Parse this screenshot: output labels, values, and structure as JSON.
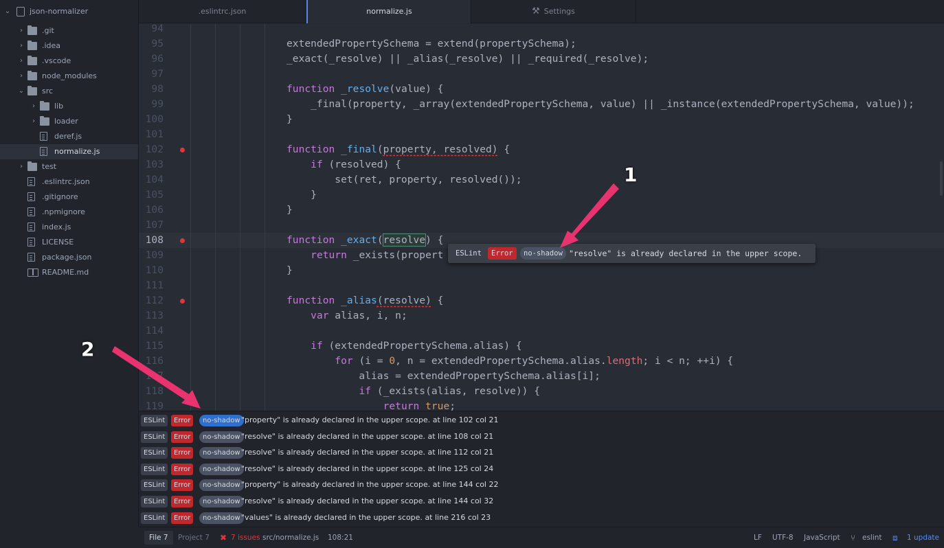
{
  "sidebar": {
    "project": "json-normalizer",
    "items": [
      {
        "label": ".git",
        "type": "folder",
        "depth": 0
      },
      {
        "label": ".idea",
        "type": "folder",
        "depth": 0
      },
      {
        "label": ".vscode",
        "type": "folder",
        "depth": 0
      },
      {
        "label": "node_modules",
        "type": "folder",
        "depth": 0
      },
      {
        "label": "src",
        "type": "folder-open",
        "depth": 0
      },
      {
        "label": "lib",
        "type": "folder",
        "depth": 1
      },
      {
        "label": "loader",
        "type": "folder",
        "depth": 1
      },
      {
        "label": "deref.js",
        "type": "file",
        "depth": 1
      },
      {
        "label": "normalize.js",
        "type": "file",
        "depth": 1,
        "selected": true
      },
      {
        "label": "test",
        "type": "folder",
        "depth": 0
      },
      {
        "label": ".eslintrc.json",
        "type": "file",
        "depth": 0
      },
      {
        "label": ".gitignore",
        "type": "file",
        "depth": 0
      },
      {
        "label": ".npmignore",
        "type": "file",
        "depth": 0
      },
      {
        "label": "index.js",
        "type": "file",
        "depth": 0
      },
      {
        "label": "LICENSE",
        "type": "file",
        "depth": 0
      },
      {
        "label": "package.json",
        "type": "file",
        "depth": 0
      },
      {
        "label": "README.md",
        "type": "book",
        "depth": 0
      }
    ]
  },
  "tabs": [
    {
      "label": ".eslintrc.json",
      "icon": ""
    },
    {
      "label": "normalize.js",
      "icon": "",
      "active": true
    },
    {
      "label": "Settings",
      "icon": "tools-icon"
    }
  ],
  "editor": {
    "lines": [
      {
        "n": "94",
        "code": ""
      },
      {
        "n": "95",
        "code": "extendedPropertySchema = extend(propertySchema);"
      },
      {
        "n": "96",
        "code": "_exact(_resolve) || _alias(_resolve) || _required(_resolve);"
      },
      {
        "n": "97",
        "code": ""
      },
      {
        "n": "98",
        "code": "function _resolve(value) {"
      },
      {
        "n": "99",
        "code": "    _final(property, _array(extendedPropertySchema, value) || _instance(extendedPropertySchema, value));"
      },
      {
        "n": "100",
        "code": "}"
      },
      {
        "n": "101",
        "code": ""
      },
      {
        "n": "102",
        "code": "function _final(property, resolved) {",
        "error": true
      },
      {
        "n": "103",
        "code": "    if (resolved) {"
      },
      {
        "n": "104",
        "code": "        set(ret, property, resolved());"
      },
      {
        "n": "105",
        "code": "    }"
      },
      {
        "n": "106",
        "code": "}"
      },
      {
        "n": "107",
        "code": ""
      },
      {
        "n": "108",
        "code": "function _exact(resolve) {",
        "error": true,
        "cursor": true
      },
      {
        "n": "109",
        "code": "    return _exists(propert"
      },
      {
        "n": "110",
        "code": "}"
      },
      {
        "n": "111",
        "code": ""
      },
      {
        "n": "112",
        "code": "function _alias(resolve) {",
        "error": true
      },
      {
        "n": "113",
        "code": "    var alias, i, n;"
      },
      {
        "n": "114",
        "code": ""
      },
      {
        "n": "115",
        "code": "    if (extendedPropertySchema.alias) {"
      },
      {
        "n": "116",
        "code": "        for (i = 0, n = extendedPropertySchema.alias.length; i < n; ++i) {"
      },
      {
        "n": "117",
        "code": "            alias = extendedPropertySchema.alias[i];"
      },
      {
        "n": "118",
        "code": "            if (_exists(alias, resolve)) {"
      },
      {
        "n": "119",
        "code": "                return true;"
      }
    ]
  },
  "tooltip": {
    "linter": "ESLint",
    "severity": "Error",
    "rule": "no-shadow",
    "message": "\"resolve\" is already declared in the upper scope."
  },
  "annotations": {
    "one": "1",
    "two": "2"
  },
  "panel": {
    "rows": [
      {
        "linter": "ESLint",
        "severity": "Error",
        "rule": "no-shadow",
        "message": "\"property\" is already declared in the upper scope.",
        "loc": "at line 102 col 21",
        "selected": true
      },
      {
        "linter": "ESLint",
        "severity": "Error",
        "rule": "no-shadow",
        "message": "\"resolve\" is already declared in the upper scope.",
        "loc": "at line 108 col 21"
      },
      {
        "linter": "ESLint",
        "severity": "Error",
        "rule": "no-shadow",
        "message": "\"resolve\" is already declared in the upper scope.",
        "loc": "at line 112 col 21"
      },
      {
        "linter": "ESLint",
        "severity": "Error",
        "rule": "no-shadow",
        "message": "\"resolve\" is already declared in the upper scope.",
        "loc": "at line 125 col 24"
      },
      {
        "linter": "ESLint",
        "severity": "Error",
        "rule": "no-shadow",
        "message": "\"property\" is already declared in the upper scope.",
        "loc": "at line 144 col 22"
      },
      {
        "linter": "ESLint",
        "severity": "Error",
        "rule": "no-shadow",
        "message": "\"resolve\" is already declared in the upper scope.",
        "loc": "at line 144 col 32"
      },
      {
        "linter": "ESLint",
        "severity": "Error",
        "rule": "no-shadow",
        "message": "\"values\" is already declared in the upper scope.",
        "loc": "at line 216 col 23"
      }
    ]
  },
  "statusbar": {
    "file_tab": "File",
    "file_count": "7",
    "project_tab": "Project",
    "project_count": "7",
    "issues": "7 issues",
    "path": "src/normalize.js",
    "cursor": "108:21",
    "line_ending": "LF",
    "encoding": "UTF-8",
    "grammar": "JavaScript",
    "branch": "eslint",
    "update": "1 update"
  },
  "colors": {
    "error": "#c0282d",
    "accent": "#568af2",
    "annotation_arrow": "#e8336e"
  }
}
